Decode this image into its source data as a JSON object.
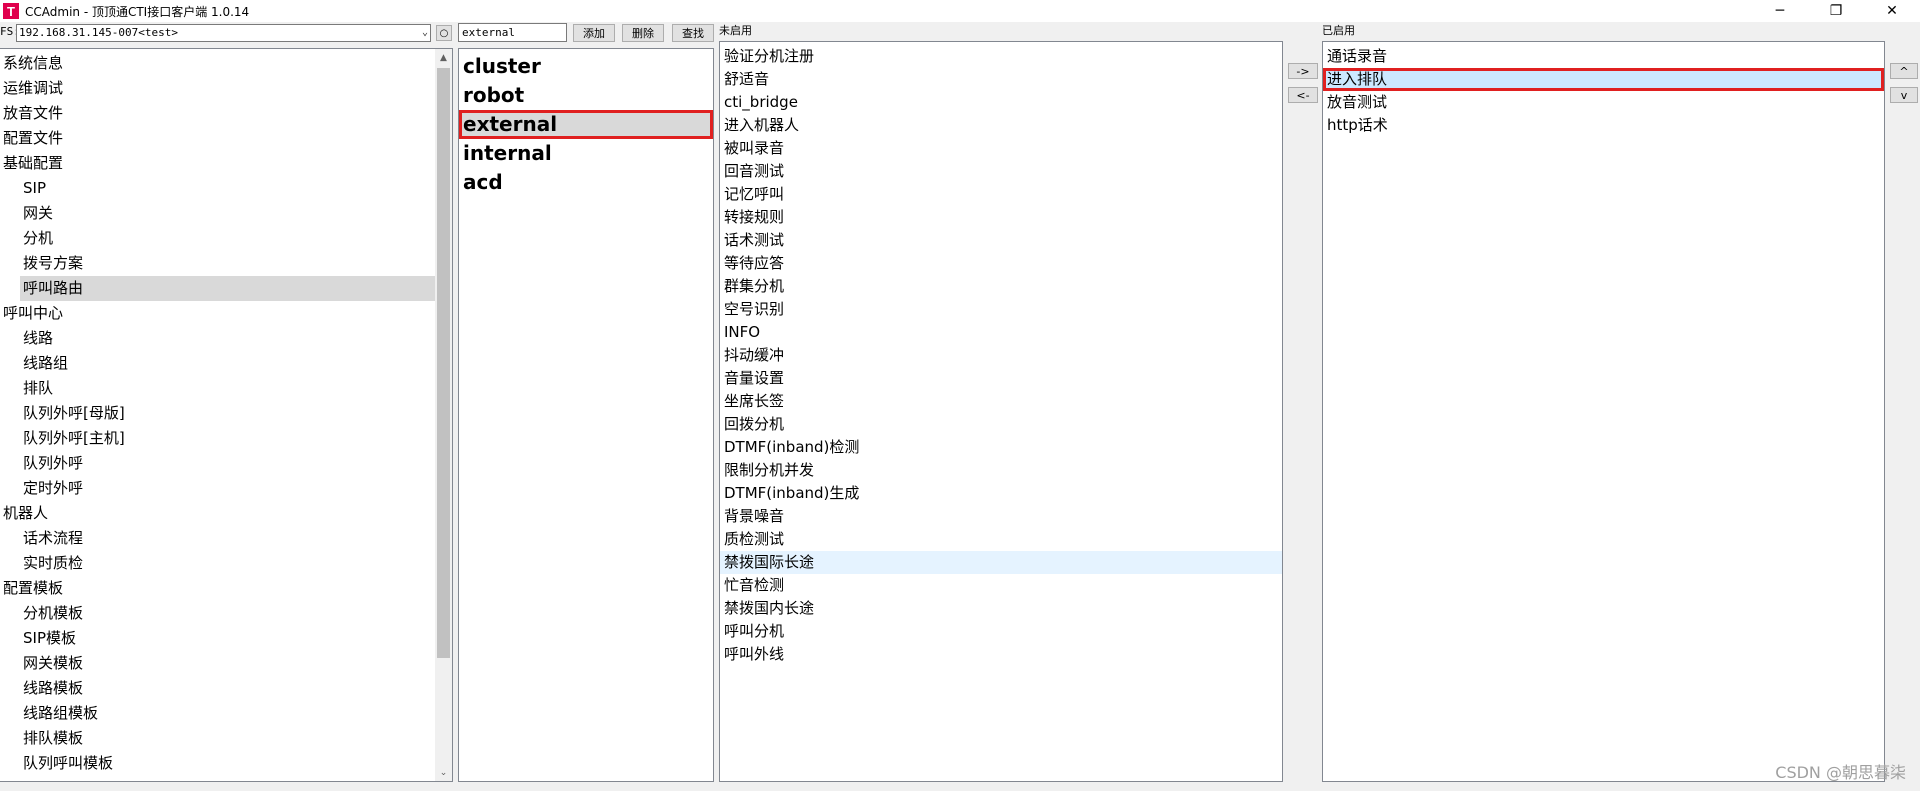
{
  "window": {
    "title": "CCAdmin - 顶顶通CTI接口客户端 1.0.14",
    "icon_letter": "T",
    "minimize": "─",
    "restore": "❐",
    "close": "✕"
  },
  "toolbar": {
    "fs_label": "FS:",
    "server_value": "192.168.31.145-007<test>",
    "refresh_icon": "○",
    "search_value": "external",
    "add_label": "添加",
    "delete_label": "删除",
    "find_label": "查找"
  },
  "tree": {
    "items": [
      {
        "label": "系统信息",
        "level": 0
      },
      {
        "label": "运维调试",
        "level": 0
      },
      {
        "label": "放音文件",
        "level": 0
      },
      {
        "label": "配置文件",
        "level": 0
      },
      {
        "label": "基础配置",
        "level": 0
      },
      {
        "label": "SIP",
        "level": 1
      },
      {
        "label": "网关",
        "level": 1
      },
      {
        "label": "分机",
        "level": 1
      },
      {
        "label": "拨号方案",
        "level": 1
      },
      {
        "label": "呼叫路由",
        "level": 1,
        "selected": true
      },
      {
        "label": "呼叫中心",
        "level": 0
      },
      {
        "label": "线路",
        "level": 1
      },
      {
        "label": "线路组",
        "level": 1
      },
      {
        "label": "排队",
        "level": 1
      },
      {
        "label": "队列外呼[母版]",
        "level": 1
      },
      {
        "label": "队列外呼[主机]",
        "level": 1
      },
      {
        "label": "队列外呼",
        "level": 1
      },
      {
        "label": "定时外呼",
        "level": 1
      },
      {
        "label": "机器人",
        "level": 0
      },
      {
        "label": "话术流程",
        "level": 1
      },
      {
        "label": "实时质检",
        "level": 1
      },
      {
        "label": "配置模板",
        "level": 0
      },
      {
        "label": "分机模板",
        "level": 1
      },
      {
        "label": "SIP模板",
        "level": 1
      },
      {
        "label": "网关模板",
        "level": 1
      },
      {
        "label": "线路模板",
        "level": 1
      },
      {
        "label": "线路组模板",
        "level": 1
      },
      {
        "label": "排队模板",
        "level": 1
      },
      {
        "label": "队列呼叫模板",
        "level": 1
      }
    ]
  },
  "contexts": {
    "items": [
      "cluster",
      "robot",
      "external",
      "internal",
      "acd"
    ],
    "selected_index": 2
  },
  "disabled_panel": {
    "label": "未启用",
    "items": [
      "验证分机注册",
      "舒适音",
      "cti_bridge",
      "进入机器人",
      "被叫录音",
      "回音测试",
      "记忆呼叫",
      "转接规则",
      "话术测试",
      "等待应答",
      "群集分机",
      "空号识别",
      "INFO",
      "抖动缓冲",
      "音量设置",
      "坐席长签",
      "回拨分机",
      "DTMF(inband)检测",
      "限制分机并发",
      "DTMF(inband)生成",
      "背景噪音",
      "质检测试",
      "禁拨国际长途",
      "忙音检测",
      "禁拨国内长途",
      "呼叫分机",
      "呼叫外线"
    ],
    "hover_index": 22
  },
  "enabled_panel": {
    "label": "已启用",
    "items": [
      "通话录音",
      "进入排队",
      "放音测试",
      "http话术"
    ],
    "selected_index": 1
  },
  "move": {
    "right_label": "->",
    "left_label": "<-",
    "up_label": "^",
    "down_label": "v"
  },
  "watermark": "CSDN @朝思暮柒"
}
